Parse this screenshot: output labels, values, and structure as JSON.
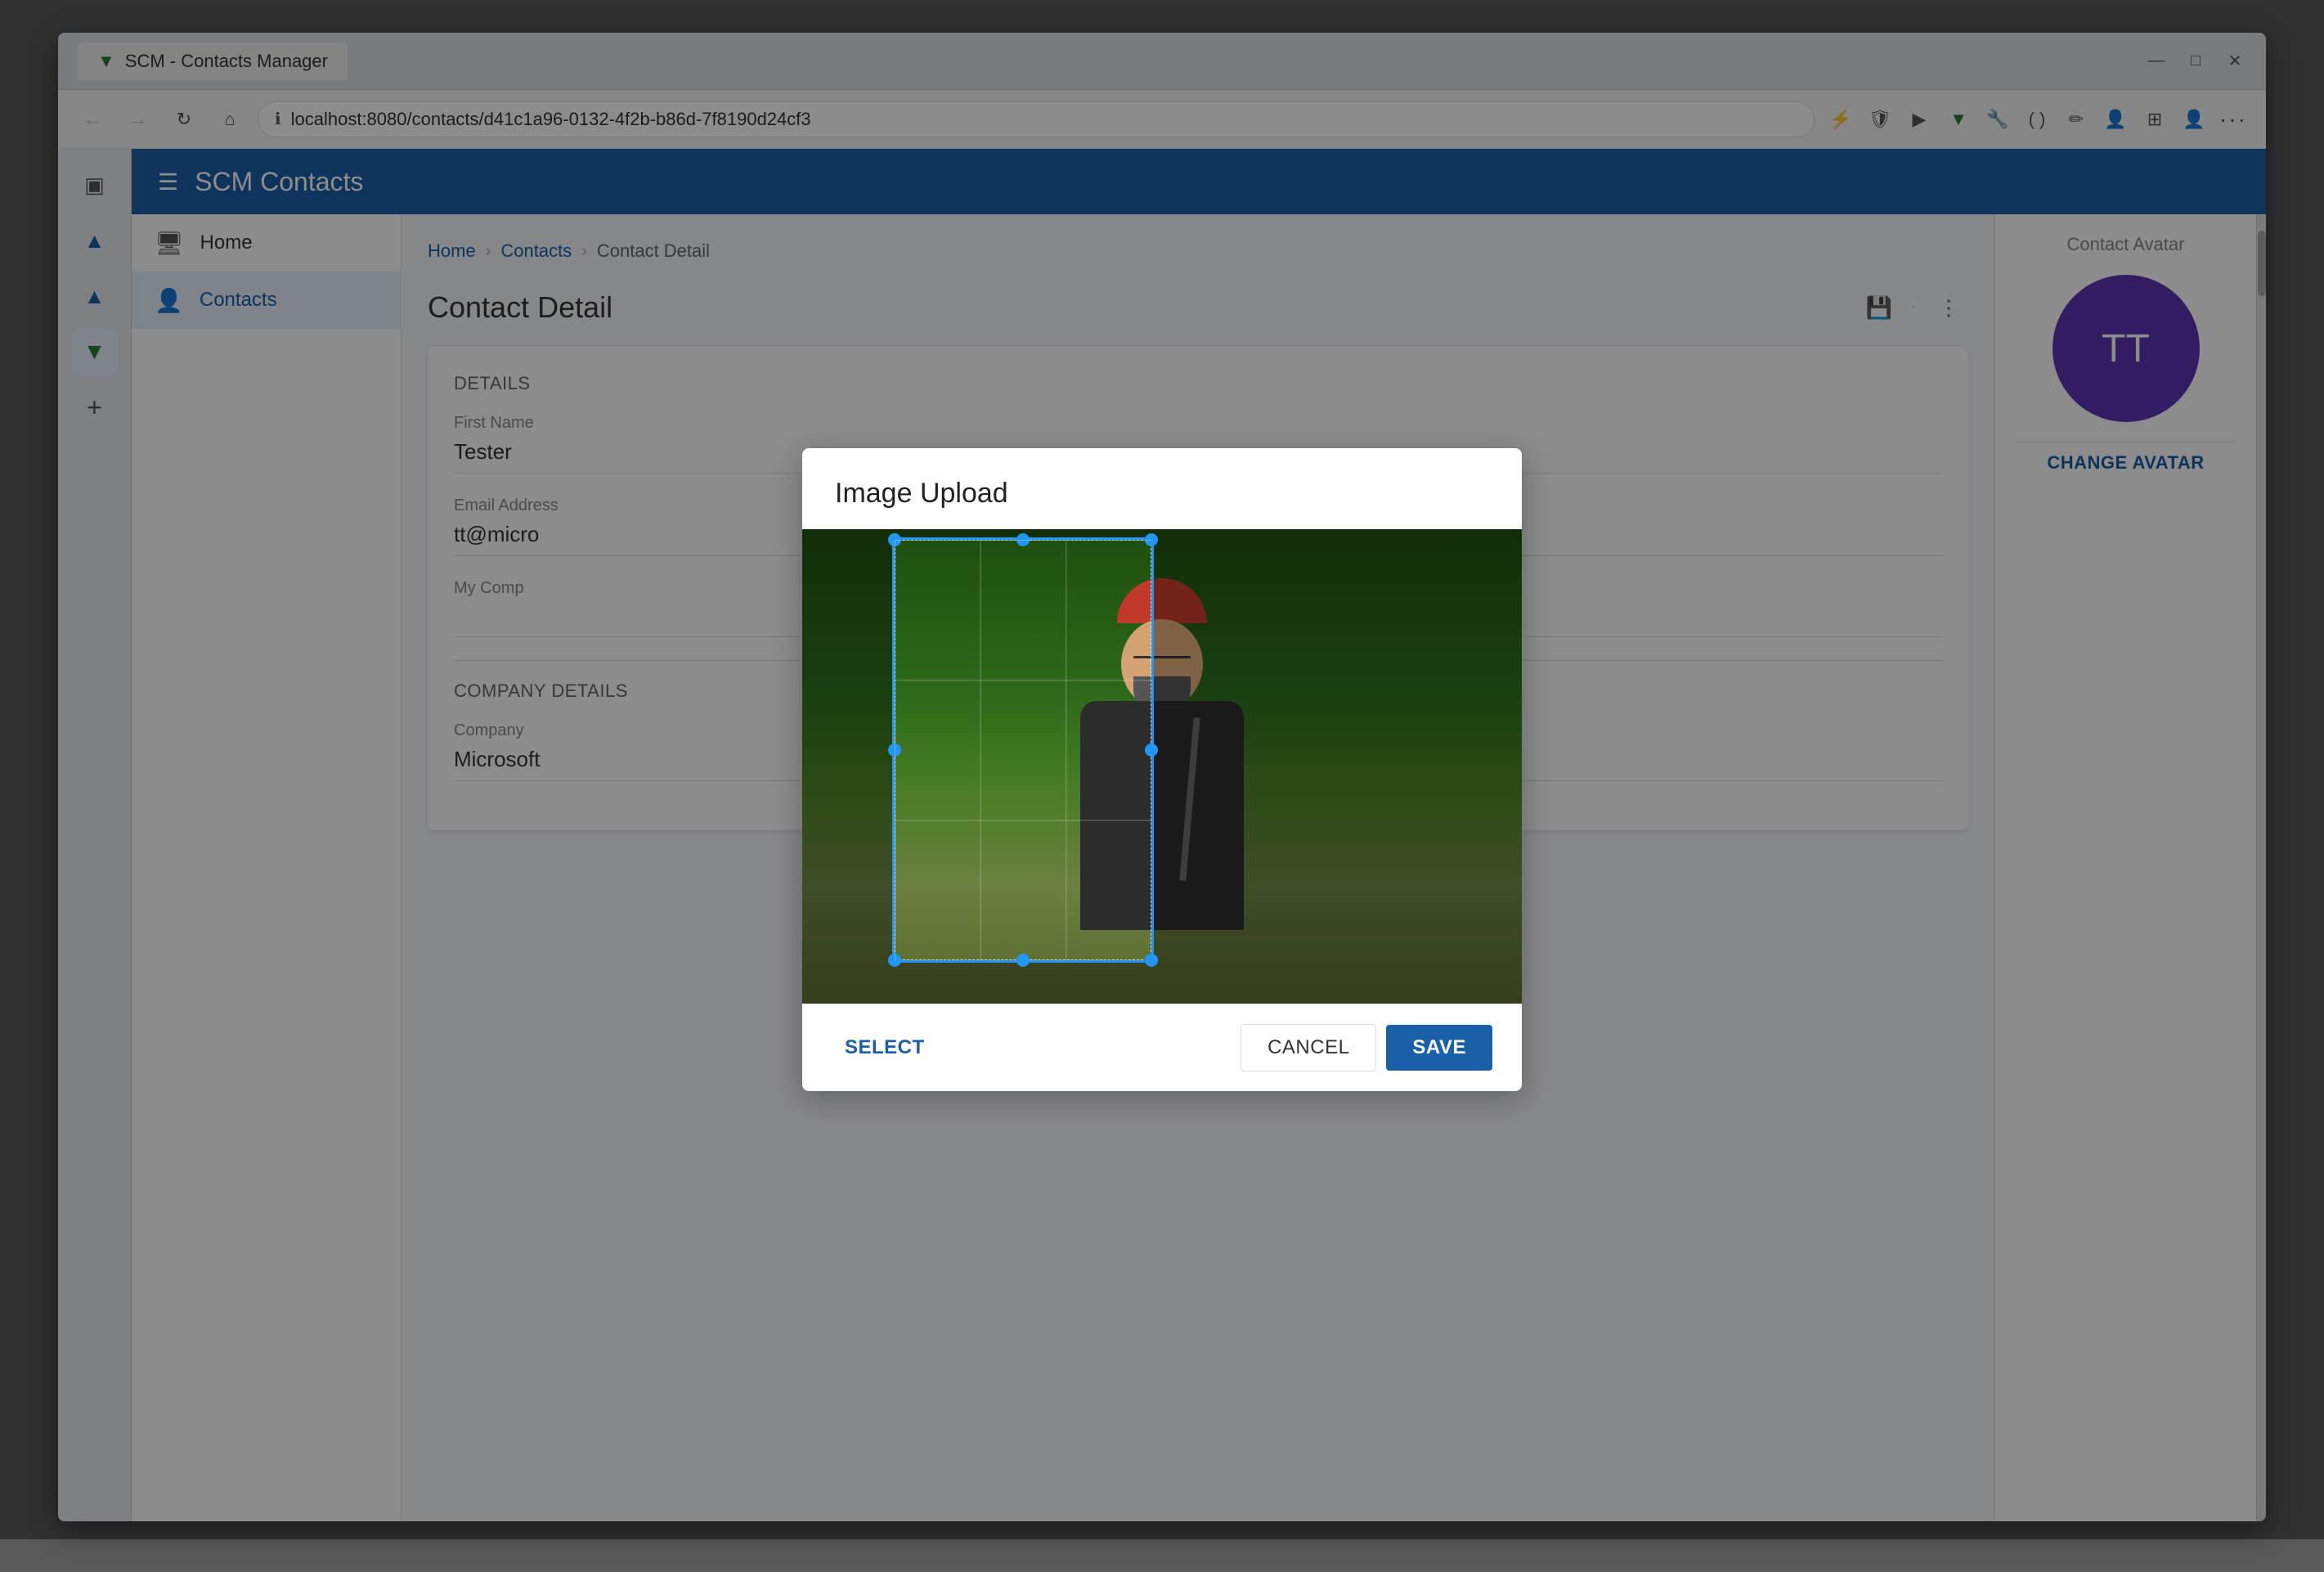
{
  "browser": {
    "tab_title": "SCM - Contacts Manager",
    "url": "localhost:8080/contacts/d41c1a96-0132-4f2b-b86d-7f8190d24cf3",
    "window_controls": {
      "minimize": "—",
      "maximize": "□",
      "close": "✕"
    }
  },
  "app": {
    "header": {
      "title": "SCM Contacts",
      "menu_icon": "☰"
    },
    "sidebar": {
      "items": [
        {
          "id": "home",
          "label": "Home",
          "icon": "🖥"
        },
        {
          "id": "contacts",
          "label": "Contacts",
          "icon": "👤"
        }
      ]
    },
    "sidebar_icons": [
      {
        "id": "gallery",
        "icon": "▣"
      },
      {
        "id": "triangle1",
        "icon": "▲"
      },
      {
        "id": "triangle2",
        "icon": "▲"
      },
      {
        "id": "logo",
        "icon": "▼",
        "active": true
      },
      {
        "id": "add",
        "icon": "+"
      }
    ]
  },
  "page": {
    "breadcrumb": [
      {
        "label": "Home",
        "link": true
      },
      {
        "label": "Contacts",
        "link": true
      },
      {
        "label": "Contact Detail",
        "link": false
      }
    ],
    "title": "Contact Detail",
    "contact": {
      "sections": {
        "details": "Details",
        "company_details": "Company Details"
      },
      "fields": {
        "first_name_label": "First Name",
        "first_name_value": "Tester",
        "email_label": "Email Address",
        "email_value": "tt@micro",
        "my_company_label": "My Comp",
        "company_label": "Company",
        "company_value": "Microsoft"
      }
    },
    "avatar": {
      "title": "Contact Avatar",
      "initials": "TT",
      "change_label": "CHANGE AVATAR"
    }
  },
  "dialog": {
    "title": "Image Upload",
    "select_label": "SELECT",
    "cancel_label": "CANCEL",
    "save_label": "SAVE"
  }
}
